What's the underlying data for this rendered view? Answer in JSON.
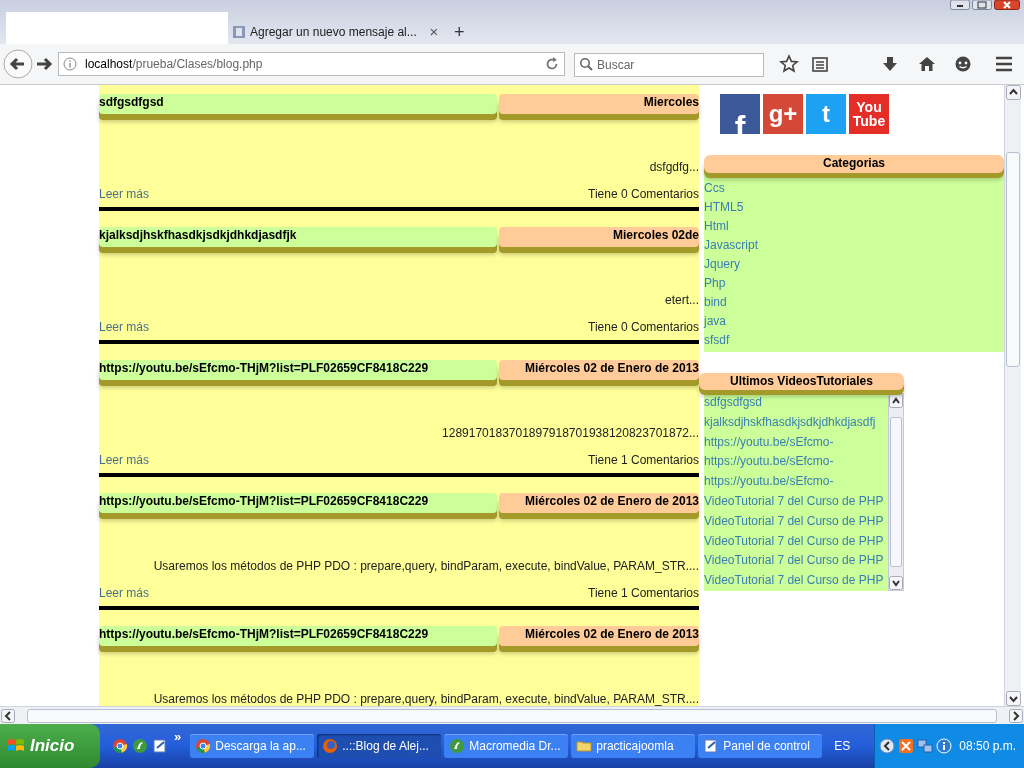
{
  "browser": {
    "tab": {
      "title": "Agregar un nuevo mensaje al...",
      "close": "×"
    },
    "new_tab": "+",
    "url": {
      "host": "localhost",
      "path": "/prueba/Clases/blog.php"
    },
    "search": {
      "placeholder": "Buscar"
    }
  },
  "posts": [
    {
      "title": "sdfgsdfgsd",
      "date": "Miercoles",
      "excerpt": "dsfgdfg...",
      "read_more": "Leer más",
      "comments": "Tiene 0 Comentarios"
    },
    {
      "title": "kjalksdjhskfhasdkjsdkjdhkdjasdfjk",
      "date": "Miercoles 02de",
      "excerpt": "etert...",
      "read_more": "Leer más",
      "comments": "Tiene 0 Comentarios"
    },
    {
      "title": "https://youtu.be/sEfcmo-THjM?list=PLF02659CF8418C229",
      "date": "Miércoles 02 de Enero de 2013",
      "excerpt": "1289170183701897918701938120823701872...",
      "read_more": "Leer más",
      "comments": "Tiene 1 Comentarios"
    },
    {
      "title": "https://youtu.be/sEfcmo-THjM?list=PLF02659CF8418C229",
      "date": "Miércoles 02 de Enero de 2013",
      "excerpt": "Usaremos los métodos de PHP PDO : prepare,query, bindParam, execute, bindValue, PARAM_STR....",
      "read_more": "Leer más",
      "comments": "Tiene 1 Comentarios"
    },
    {
      "title": "https://youtu.be/sEfcmo-THjM?list=PLF02659CF8418C229",
      "date": "Miércoles 02 de Enero de 2013",
      "excerpt": "Usaremos los métodos de PHP PDO : prepare,query, bindParam, execute, bindValue, PARAM_STR...."
    }
  ],
  "social": [
    {
      "label": "f",
      "color": "#3b5998"
    },
    {
      "label": "g+",
      "color": "#d34836"
    },
    {
      "label": "t",
      "color": "#1da1f2"
    },
    {
      "label": "You Tube",
      "color": "#e52d27"
    }
  ],
  "categories": {
    "title": "Categorias",
    "items": [
      "Ccs",
      "HTML5",
      "Html",
      "Javascript",
      "Jquery",
      "Php",
      "bind",
      "java",
      "sfsdf"
    ]
  },
  "videos": {
    "title": "Ultimos VideosTutoriales",
    "items": [
      "sdfgsdfgsd",
      "kjalksdjhskfhasdkjsdkjdhkdjasdfj",
      "https://youtu.be/sEfcmo-",
      "https://youtu.be/sEfcmo-",
      "https://youtu.be/sEfcmo-",
      "VideoTutorial 7 del Curso de PHP",
      "VideoTutorial 7 del Curso de PHP",
      "VideoTutorial 7 del Curso de PHP",
      "VideoTutorial 7 del Curso de PHP",
      "VideoTutorial 7 del Curso de PHP"
    ]
  },
  "taskbar": {
    "start": "Inicio",
    "more": "»",
    "tasks": [
      {
        "label": "Descarga la ap...",
        "selected": false
      },
      {
        "label": "..::Blog de Alej...",
        "selected": true
      },
      {
        "label": "Macromedia Dr...",
        "selected": false
      },
      {
        "label": "practicajoomla",
        "selected": false
      },
      {
        "label": "Panel de control",
        "selected": false
      }
    ],
    "language": "ES",
    "clock": "08:50 p.m."
  }
}
